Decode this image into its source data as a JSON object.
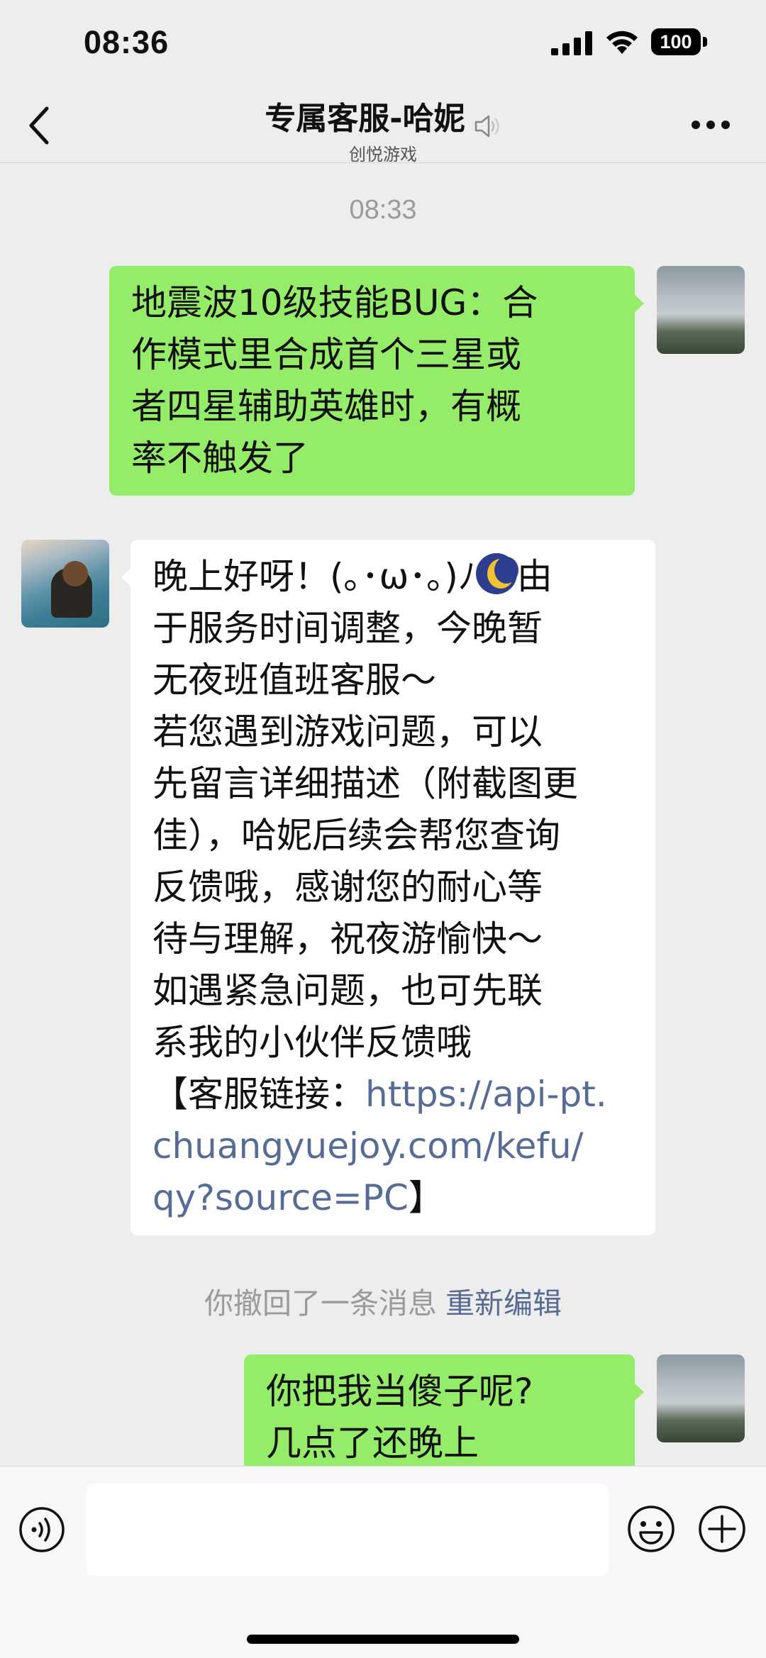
{
  "status_bar": {
    "time": "08:36",
    "battery": "100",
    "icons": [
      "signal-icon",
      "wifi-icon",
      "battery-icon"
    ]
  },
  "nav": {
    "title": "专属客服-哈妮",
    "subtitle": "创悦游戏",
    "icons": [
      "back-chevron-icon",
      "mute-icon",
      "more-dots-icon"
    ]
  },
  "chat": {
    "timestamp": "08:33",
    "messages": [
      {
        "from": "me",
        "lines": [
          "地震波10级技能BUG：合",
          "作模式里合成首个三星或",
          "者四星辅助英雄时，有概",
          "率不触发了"
        ]
      },
      {
        "from": "agent",
        "line1_start": "晚上好呀！(｡･ω･｡)ﾉ",
        "line1_emoji": "crescent-moon-emoji",
        "line1_end": "由",
        "lines": [
          "于服务时间调整，今晚暂",
          "无夜班值班客服～",
          "若您遇到游戏问题，可以",
          "先留言详细描述（附截图更",
          "佳），哈妮后续会帮您查询",
          "反馈哦，感谢您的耐心等",
          "待与理解，祝夜游愉快～",
          "如遇紧急问题，也可先联",
          "系我的小伙伴反馈哦"
        ],
        "link_prefix": "【客服链接：",
        "link_line1": "https://api-pt.",
        "link_line2": "chuangyuejoy.com/kefu/",
        "link_line3": "qy?source=PC",
        "link_suffix": "】"
      },
      {
        "from": "me",
        "lines": [
          "你把我当傻子呢?",
          "几点了还晚上"
        ]
      }
    ],
    "recall_notice": "你撤回了一条消息",
    "recall_edit": "重新编辑"
  },
  "input_bar": {
    "text": "",
    "icons": [
      "voice-icon",
      "emoji-icon",
      "plus-icon"
    ]
  },
  "colors": {
    "background": "#ededed",
    "my_bubble": "#95ec69",
    "their_bubble": "#ffffff",
    "link": "#576b95",
    "meta_text": "#9a9a9a"
  }
}
